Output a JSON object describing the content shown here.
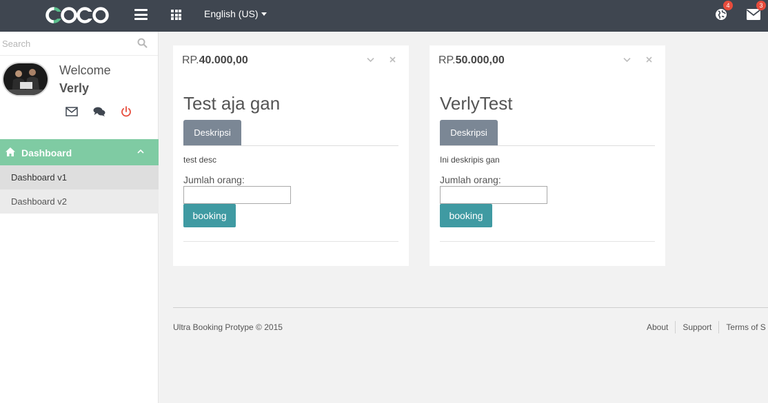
{
  "header": {
    "logo_text": "COCO",
    "language": "English (US)",
    "globe_badge": "4",
    "mail_badge": "3"
  },
  "sidebar": {
    "search_placeholder": "Search",
    "welcome": "Welcome",
    "username": "Verly",
    "menu": {
      "dashboard": "Dashboard",
      "items": [
        "Dashboard v1",
        "Dashboard v2"
      ]
    }
  },
  "cards": [
    {
      "price_prefix": "RP.",
      "price": "40.000,00",
      "title": "Test aja gan",
      "tab": "Deskripsi",
      "description": "test desc",
      "qty_label": "Jumlah orang:",
      "qty_value": "",
      "button": "booking"
    },
    {
      "price_prefix": "RP.",
      "price": "50.000,00",
      "title": "VerlyTest",
      "tab": "Deskripsi",
      "description": "Ini deskripis gan",
      "qty_label": "Jumlah orang:",
      "qty_value": "",
      "button": "booking"
    }
  ],
  "footer": {
    "copyright": "Ultra Booking Protype © 2015",
    "links": [
      "About",
      "Support",
      "Terms of S"
    ]
  },
  "colors": {
    "topbar": "#3f4650",
    "accent_green": "#7fcba3",
    "logo_green": "#5bbf8d",
    "button_teal": "#3f9aa2",
    "tab_gray": "#7b8795",
    "badge_red": "#e74c3c",
    "power_red": "#e74c3c"
  }
}
